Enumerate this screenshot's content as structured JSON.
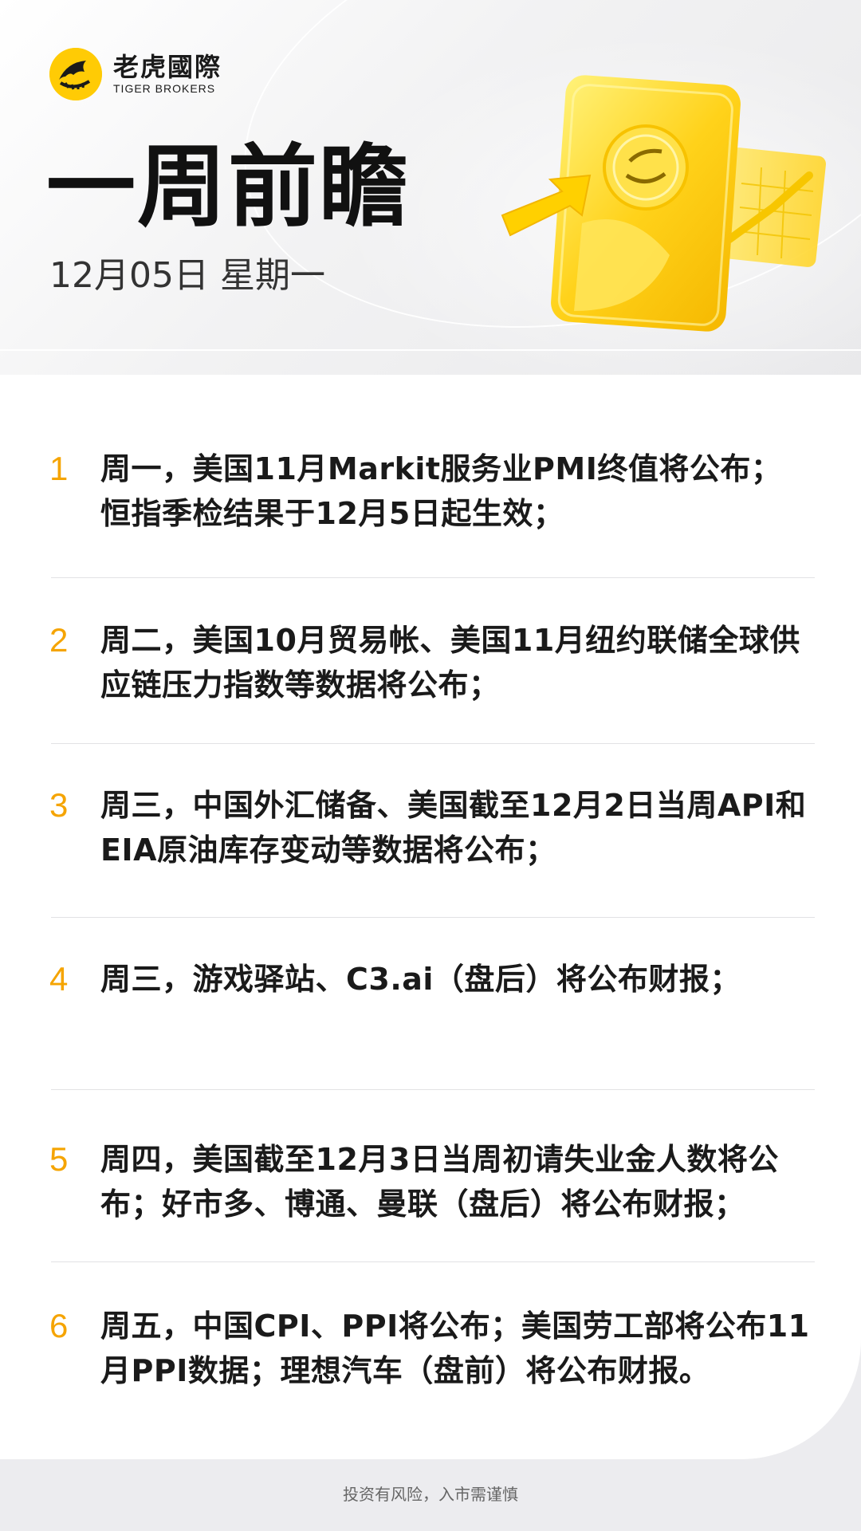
{
  "brand": {
    "name_cn": "老虎國際",
    "name_en": "TIGER BROKERS",
    "logo_icon": "tiger-logo-icon",
    "accent": "#ffcb05"
  },
  "header": {
    "title": "一周前瞻",
    "date": "12月05日 星期一"
  },
  "items": [
    {
      "num": "1",
      "text": "周一，美国11月Markit服务业PMI终值将公布；恒指季检结果于12月5日起生效；"
    },
    {
      "num": "2",
      "text": "周二，美国10月贸易帐、美国11月纽约联储全球供应链压力指数等数据将公布；"
    },
    {
      "num": "3",
      "text": "周三，中国外汇储备、美国截至12月2日当周API和EIA原油库存变动等数据将公布；"
    },
    {
      "num": "4",
      "text": "周三，游戏驿站、C3.ai（盘后）将公布财报；"
    },
    {
      "num": "5",
      "text": "周四，美国截至12月3日当周初请失业金人数将公布；好市多、博通、曼联（盘后）将公布财报；"
    },
    {
      "num": "6",
      "text": "周五，中国CPI、PPI将公布；美国劳工部将公布11月PPI数据；理想汽车（盘前）将公布财报。"
    }
  ],
  "footer": {
    "disclaimer": "投资有风险，入市需谨慎"
  },
  "colors": {
    "number": "#f5a400",
    "text": "#1a1a1a"
  }
}
